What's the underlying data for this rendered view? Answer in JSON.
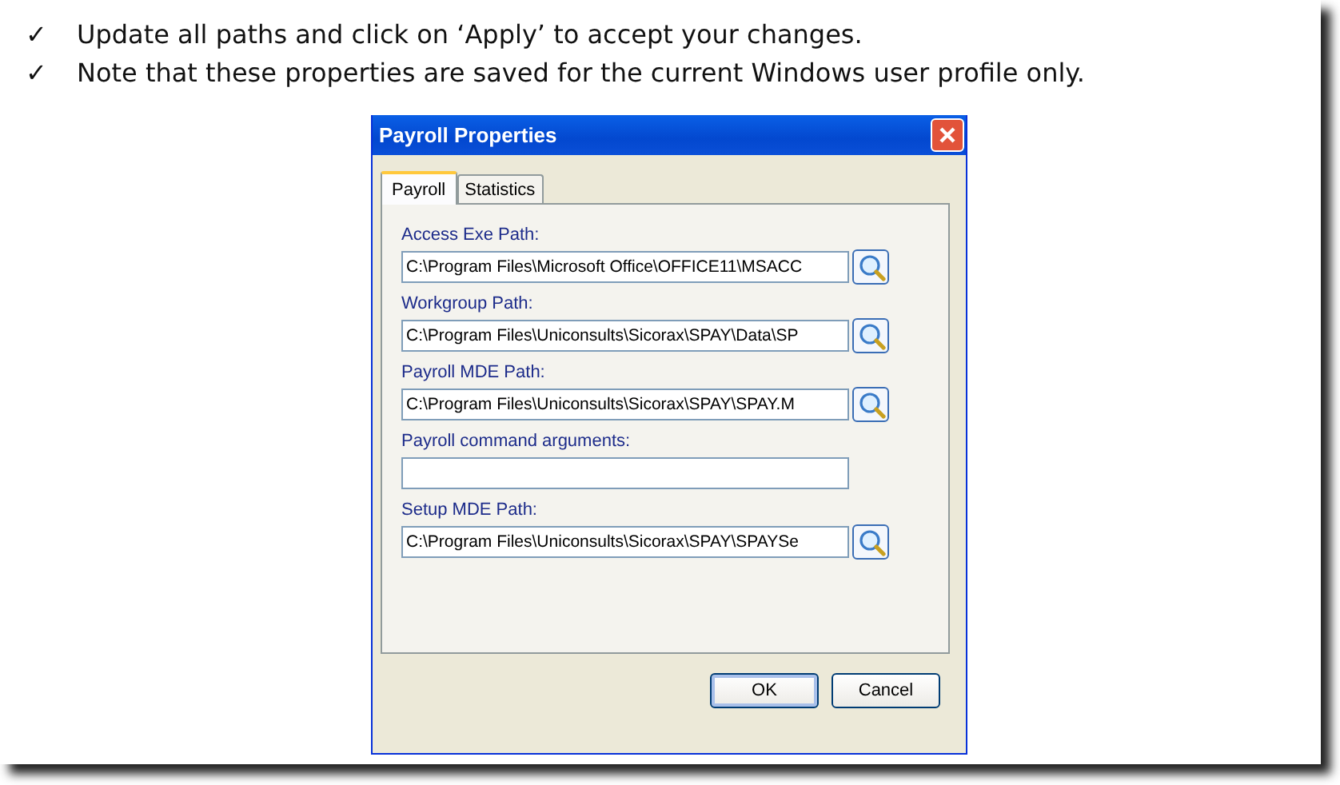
{
  "notes": [
    {
      "mark": "✓",
      "text": "Update all paths and click on ‘Apply’ to accept your changes."
    },
    {
      "mark": "✓",
      "text": "Note that these properties are saved for the current Windows user profile only."
    }
  ],
  "dialog": {
    "title": "Payroll Properties",
    "tabs": [
      {
        "label": "Payroll",
        "selected": true
      },
      {
        "label": "Statistics",
        "selected": false
      }
    ],
    "fields": [
      {
        "kind": "path",
        "label": "Access Exe Path:",
        "value": "C:\\Program Files\\Microsoft Office\\OFFICE11\\MSACC"
      },
      {
        "kind": "path",
        "label": "Workgroup Path:",
        "value": "C:\\Program Files\\Uniconsults\\Sicorax\\SPAY\\Data\\SP"
      },
      {
        "kind": "path",
        "label": "Payroll MDE Path:",
        "value": "C:\\Program Files\\Uniconsults\\Sicorax\\SPAY\\SPAY.M"
      },
      {
        "kind": "text",
        "label": "Payroll command arguments:"
      },
      {
        "kind": "path",
        "label": "Setup MDE Path:",
        "value": "C:\\Program Files\\Uniconsults\\Sicorax\\SPAY\\SPAYSe"
      }
    ],
    "buttons": [
      {
        "label": "OK",
        "default": true
      },
      {
        "label": "Cancel",
        "default": false
      }
    ]
  }
}
